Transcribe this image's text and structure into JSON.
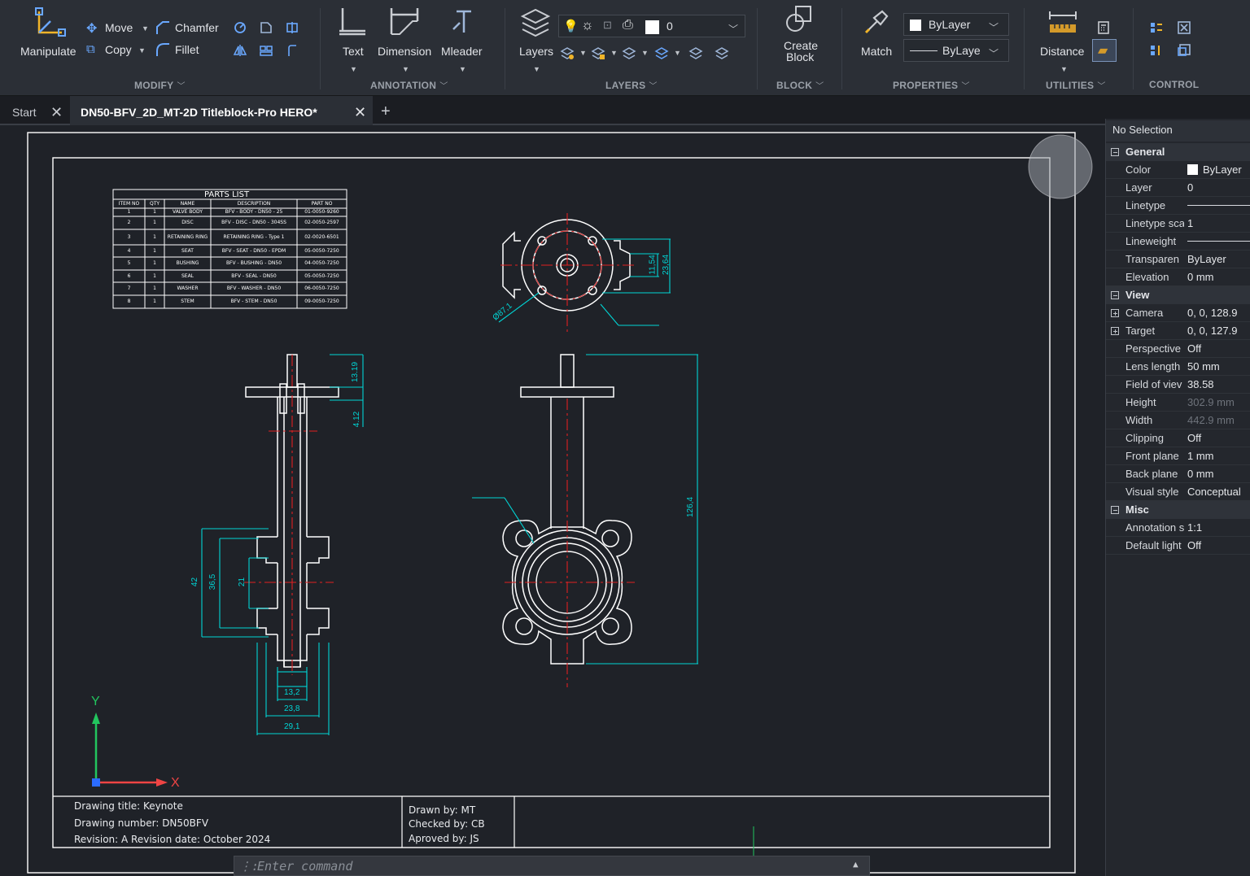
{
  "ribbon": {
    "modify": {
      "title": "MODIFY",
      "manipulate": "Manipulate",
      "move": "Move",
      "copy": "Copy",
      "chamfer": "Chamfer",
      "fillet": "Fillet"
    },
    "annotation": {
      "title": "ANNOTATION",
      "text": "Text",
      "dimension": "Dimension",
      "mleader": "Mleader"
    },
    "layers": {
      "title": "LAYERS",
      "layers": "Layers",
      "current_layer": "0"
    },
    "block": {
      "title": "BLOCK",
      "create_block_line1": "Create",
      "create_block_line2": "Block"
    },
    "properties": {
      "title": "PROPERTIES",
      "match": "Match",
      "color_combo": "ByLayer",
      "linetype_combo": "ByLaye"
    },
    "utilities": {
      "title": "UTILITIES",
      "distance": "Distance"
    },
    "control": {
      "title": "CONTROL"
    }
  },
  "tabs": {
    "start": "Start",
    "document": "DN50-BFV_2D_MT-2D Titleblock-Pro HERO*"
  },
  "drawing": {
    "parts_list": {
      "title": "PARTS LIST",
      "headers": [
        "ITEM NO",
        "QTY",
        "NAME",
        "DESCRIPTION",
        "PART NO"
      ],
      "rows": [
        [
          "1",
          "1",
          "VALVE BODY",
          "BFV - BODY - DN50 - 25",
          "01-0050-9260"
        ],
        [
          "2",
          "1",
          "DISC",
          "BFV - DISC - DN50 - 304SS",
          "02-0050-2597"
        ],
        [
          "3",
          "1",
          "RETAINING RING",
          "RETAINING RING - Type 1",
          "02-0020-6501"
        ],
        [
          "4",
          "1",
          "SEAT",
          "BFV - SEAT - DN50 - EPDM",
          "05-0050-7250"
        ],
        [
          "5",
          "1",
          "BUSHING",
          "BFV - BUSHING - DN50",
          "04-0050-7250"
        ],
        [
          "6",
          "1",
          "SEAL",
          "BFV - SEAL - DN50",
          "05-0050-7250"
        ],
        [
          "7",
          "1",
          "WASHER",
          "BFV - WASHER - DN50",
          "06-0050-7250"
        ],
        [
          "8",
          "1",
          "STEM",
          "BFV - STEM - DN50",
          "09-0050-7250"
        ]
      ]
    },
    "dimensions": {
      "d_top": "13.19",
      "d_small": "4.12",
      "d42": "42",
      "d365": "36,5",
      "d21": "21",
      "d132": "13,2",
      "d238": "23,8",
      "d291": "29,1",
      "d1154": "11,54",
      "d2364": "23,64",
      "d871": "Ø87,1",
      "d1264": "126,4"
    },
    "axis_y": "Y",
    "axis_x": "X",
    "titleblock": {
      "drawing_title": "Drawing title: Keynote",
      "drawing_number": "Drawing number: DN50BFV",
      "revision": "Revision: A   Revision date: October 2024",
      "drawn_by": "Drawn by: MT",
      "checked_by": "Checked by: CB",
      "approved_by": "Aproved by: JS"
    }
  },
  "command": {
    "placeholder": "Enter command"
  },
  "properties_panel": {
    "selection": "No Selection",
    "general": {
      "title": "General",
      "color_label": "Color",
      "color_value": "ByLayer",
      "layer_label": "Layer",
      "layer_value": "0",
      "linetype_label": "Linetype",
      "linetype_scale_label": "Linetype sca",
      "linetype_scale_value": "1",
      "lineweight_label": "Lineweight",
      "transparency_label": "Transparen",
      "transparency_value": "ByLayer",
      "elevation_label": "Elevation",
      "elevation_value": "0 mm"
    },
    "view": {
      "title": "View",
      "camera_label": "Camera",
      "camera_value": "0, 0, 128.9",
      "target_label": "Target",
      "target_value": "0, 0, 127.9",
      "perspective_label": "Perspective",
      "perspective_value": "Off",
      "lens_label": "Lens length",
      "lens_value": "50 mm",
      "fov_label": "Field of viev",
      "fov_value": "38.58",
      "height_label": "Height",
      "height_value": "302.9 mm",
      "width_label": "Width",
      "width_value": "442.9 mm",
      "clipping_label": "Clipping",
      "clipping_value": "Off",
      "front_label": "Front plane",
      "front_value": "1 mm",
      "back_label": "Back plane",
      "back_value": "0 mm",
      "visual_label": "Visual style",
      "visual_value": "Conceptual"
    },
    "misc": {
      "title": "Misc",
      "annotation_label": "Annotation s",
      "annotation_value": "1:1",
      "light_label": "Default light",
      "light_value": "Off"
    }
  },
  "colors": {
    "drawing_white": "#ffffff",
    "dimension_cyan": "#00d5d5",
    "centerline_red": "#e02020",
    "ucs_green": "#22c55e",
    "ucs_red": "#ef4444"
  }
}
